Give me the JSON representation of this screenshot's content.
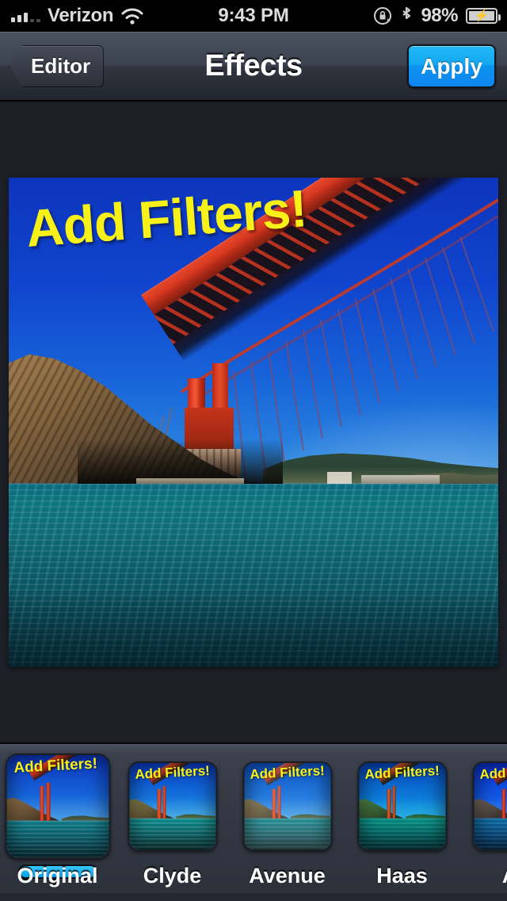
{
  "status_bar": {
    "carrier": "Verizon",
    "wifi_icon": "wifi-icon",
    "time": "9:43 PM",
    "rotation_lock_icon": "rotation-lock-icon",
    "bluetooth_icon": "bluetooth-icon",
    "battery_percent": "98%",
    "battery_state_icon": "battery-charging-icon"
  },
  "nav_bar": {
    "back_label": "Editor",
    "title": "Effects",
    "apply_label": "Apply"
  },
  "photo": {
    "caption": "Add Filters!",
    "caption_color": "#F7F119",
    "subject": "golden-gate-bridge"
  },
  "filter_strip": {
    "selected": "Original",
    "items": [
      {
        "name": "Original",
        "caption": "Add Filters!",
        "selected": true,
        "tint_class": ""
      },
      {
        "name": "Clyde",
        "caption": "Add Filters!",
        "selected": false,
        "tint_class": "t-clyde"
      },
      {
        "name": "Avenue",
        "caption": "Add Filters!",
        "selected": false,
        "tint_class": "t-avenue"
      },
      {
        "name": "Haas",
        "caption": "Add Filters!",
        "selected": false,
        "tint_class": "t-haas"
      },
      {
        "name": "Ari",
        "caption": "Add Fil",
        "selected": false,
        "tint_class": "t-ari"
      }
    ]
  },
  "colors": {
    "accent_blue": "#13A9F2",
    "navbar_dark": "#3C424F",
    "canvas_bg": "#1D2027",
    "caption_yellow": "#F7F119"
  }
}
